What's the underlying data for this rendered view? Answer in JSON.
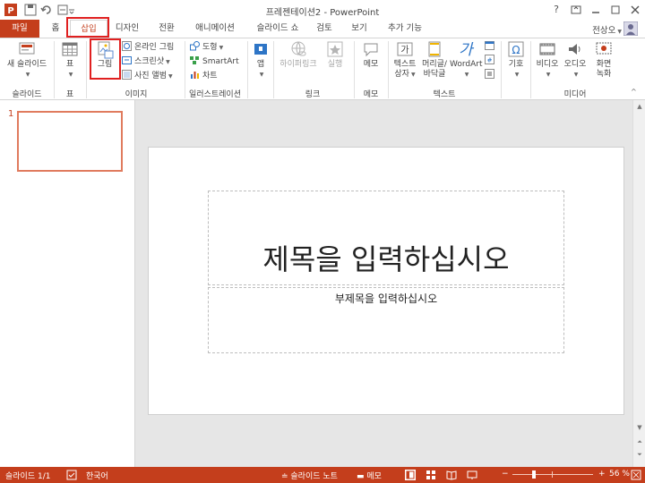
{
  "window": {
    "title": "프레젠테이션2 - PowerPoint",
    "help": "?",
    "user": "전상오"
  },
  "tabs": [
    {
      "label": "파일"
    },
    {
      "label": "홈"
    },
    {
      "label": "삽입"
    },
    {
      "label": "디자인"
    },
    {
      "label": "전환"
    },
    {
      "label": "애니메이션"
    },
    {
      "label": "슬라이드 쇼"
    },
    {
      "label": "검토"
    },
    {
      "label": "보기"
    },
    {
      "label": "추가 기능"
    }
  ],
  "ribbon": {
    "new_slide": "새 슬라이드",
    "table": "표",
    "picture": "그림",
    "online_picture": "온라인 그림",
    "screenshot": "스크린샷",
    "photo_album": "사진 앨범",
    "shapes": "도형",
    "smartart": "SmartArt",
    "chart": "차트",
    "app": "앱",
    "hyperlink": "하이퍼링크",
    "action": "실행",
    "comment": "메모",
    "textbox_line1": "텍스트",
    "textbox_line2": "상자",
    "header_line1": "머리글/",
    "header_line2": "바닥글",
    "wordart": "WordArt",
    "symbols": "기호",
    "video": "비디오",
    "audio": "오디오",
    "screen_rec_line1": "화면",
    "screen_rec_line2": "녹화",
    "groups": {
      "slides": "슬라이드",
      "tables": "표",
      "images": "이미지",
      "illustrations": "일러스트레이션",
      "links": "링크",
      "comments": "메모",
      "text": "텍스트",
      "media": "미디어"
    }
  },
  "thumbs": {
    "number": "1"
  },
  "slide": {
    "title_placeholder": "제목을 입력하십시오",
    "subtitle_placeholder": "부제목을 입력하십시오"
  },
  "status": {
    "slide_info": "슬라이드 1/1",
    "language": "한국어",
    "notes": "슬라이드 노트",
    "comments": "메모",
    "zoom": "56 %",
    "zoom_fraction": 0.56
  },
  "colors": {
    "accent": "#c43e1c",
    "highlight_box": "#e02020"
  }
}
